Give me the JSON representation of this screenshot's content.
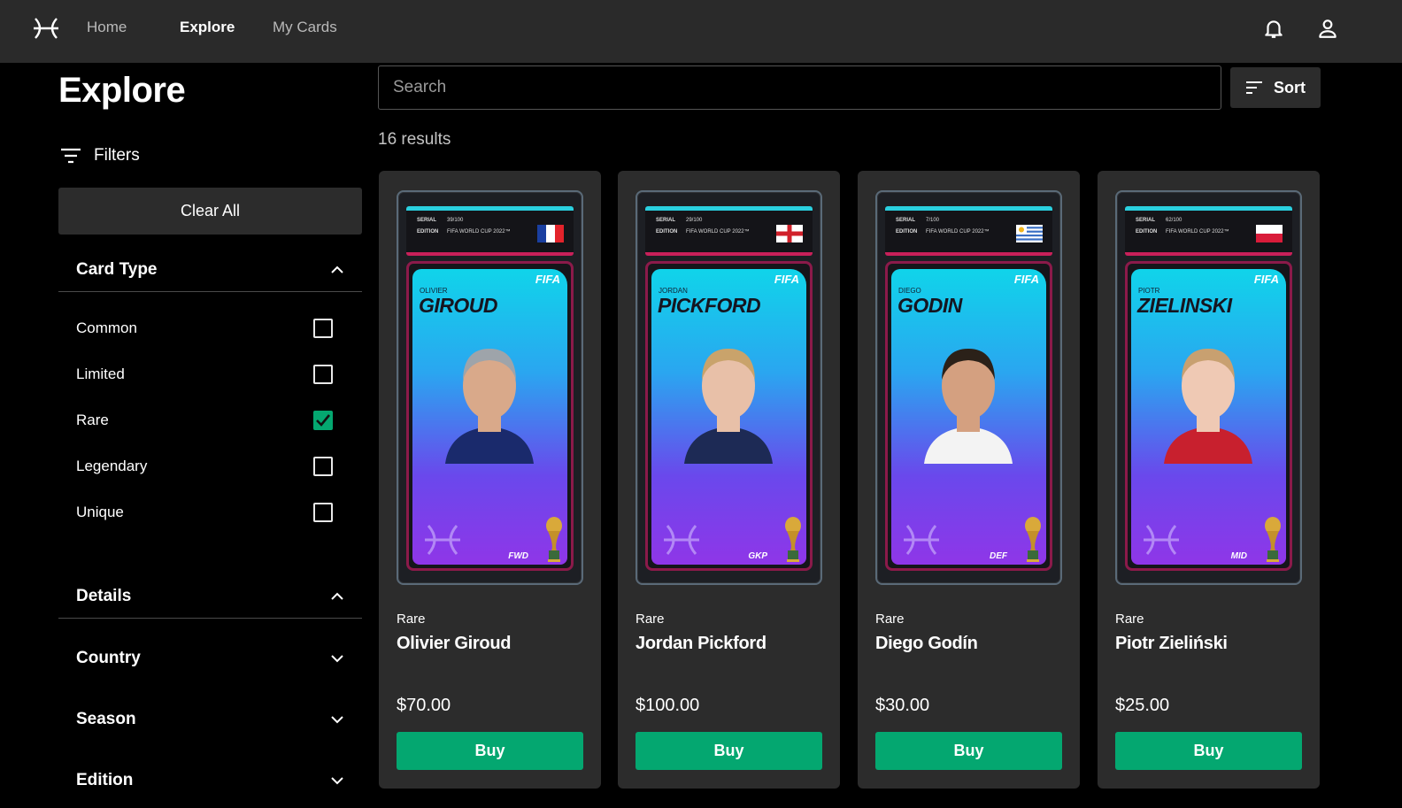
{
  "nav": {
    "links": [
      "Home",
      "Explore",
      "My Cards"
    ],
    "active": "Explore"
  },
  "sidebar": {
    "title": "Explore",
    "filters_label": "Filters",
    "clear_all": "Clear All",
    "card_type": {
      "label": "Card Type",
      "options": [
        {
          "label": "Common",
          "checked": false
        },
        {
          "label": "Limited",
          "checked": false
        },
        {
          "label": "Rare",
          "checked": true
        },
        {
          "label": "Legendary",
          "checked": false
        },
        {
          "label": "Unique",
          "checked": false
        }
      ]
    },
    "details": {
      "label": "Details",
      "sections": [
        "Country",
        "Season",
        "Edition"
      ]
    }
  },
  "search": {
    "placeholder": "Search",
    "value": ""
  },
  "sort_label": "Sort",
  "results_text": "16 results",
  "colors": {
    "accent": "#04a770",
    "panel": "#2c2c2c",
    "topbar": "#2a2a2a"
  },
  "cards": [
    {
      "rarity": "Rare",
      "name": "Olivier Giroud",
      "price": "$70.00",
      "buy": "Buy",
      "art": {
        "first": "OLIVIER",
        "last": "GIROUD",
        "position": "FWD",
        "serial_label": "SERIAL",
        "serial": "39/100",
        "edition_label": "EDITION",
        "edition": "FIFA WORLD CUP 2022™",
        "flag": "france",
        "brand": "FIFA"
      }
    },
    {
      "rarity": "Rare",
      "name": "Jordan Pickford",
      "price": "$100.00",
      "buy": "Buy",
      "art": {
        "first": "JORDAN",
        "last": "PICKFORD",
        "position": "GKP",
        "serial_label": "SERIAL",
        "serial": "29/100",
        "edition_label": "EDITION",
        "edition": "FIFA WORLD CUP 2022™",
        "flag": "england",
        "brand": "FIFA"
      }
    },
    {
      "rarity": "Rare",
      "name": "Diego Godín",
      "price": "$30.00",
      "buy": "Buy",
      "art": {
        "first": "DIEGO",
        "last": "GODIN",
        "position": "DEF",
        "serial_label": "SERIAL",
        "serial": "7/100",
        "edition_label": "EDITION",
        "edition": "FIFA WORLD CUP 2022™",
        "flag": "uruguay",
        "brand": "FIFA"
      }
    },
    {
      "rarity": "Rare",
      "name": "Piotr Zieliński",
      "price": "$25.00",
      "buy": "Buy",
      "art": {
        "first": "PIOTR",
        "last": "ZIELINSKI",
        "position": "MID",
        "serial_label": "SERIAL",
        "serial": "62/100",
        "edition_label": "EDITION",
        "edition": "FIFA WORLD CUP 2022™",
        "flag": "poland",
        "brand": "FIFA"
      }
    }
  ]
}
